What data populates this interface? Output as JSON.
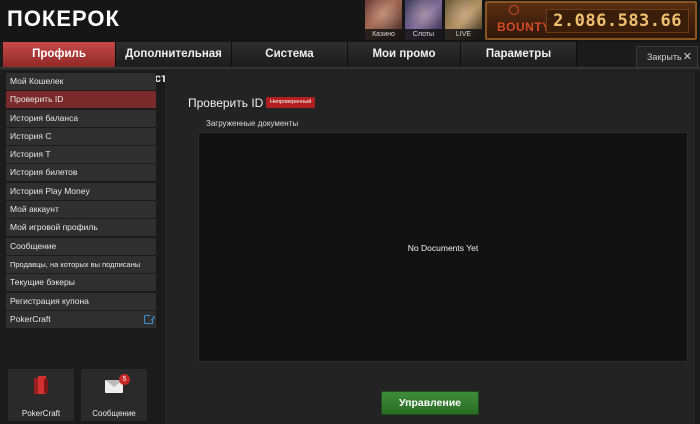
{
  "header": {
    "logo": "ПОКЕРОК",
    "thumbnails": [
      {
        "label": "Казино"
      },
      {
        "label": "Слоты"
      },
      {
        "label": "LIVE Казино"
      }
    ],
    "bounty": {
      "logo": "BOUNTY",
      "amount": "2.086.583.66"
    }
  },
  "tabs": [
    {
      "label": "Профиль",
      "active": true
    },
    {
      "label": "Дополнительная ставка"
    },
    {
      "label": "Система вознаграждений"
    },
    {
      "label": "Мои промо"
    },
    {
      "label": "Параметры"
    }
  ],
  "close_tab": {
    "label": "Закрыть",
    "icon": "close-icon",
    "glyph": "✕"
  },
  "sidebar": {
    "items": [
      {
        "label": "Мой Кошелек"
      },
      {
        "label": "Проверить ID",
        "active": true
      },
      {
        "label": "История баланса"
      },
      {
        "label": "История С"
      },
      {
        "label": "История Т"
      },
      {
        "label": "История билетов"
      },
      {
        "label": "История Play Money"
      },
      {
        "label": "Мой аккаунт"
      },
      {
        "label": "Мой игровой профиль"
      },
      {
        "label": "Сообщение"
      },
      {
        "label": "Продавцы, на которых вы подписаны"
      },
      {
        "label": "Текущие бэкеры"
      },
      {
        "label": "Регистрация купона"
      },
      {
        "label": "PokerCraft",
        "icon": "external-link-icon"
      }
    ],
    "bottom_buttons": [
      {
        "label": "PokerCraft",
        "icon": "pokercraft-icon"
      },
      {
        "label": "Сообщение",
        "icon": "envelope-icon",
        "badge": "5"
      }
    ]
  },
  "main": {
    "title": "Проверить ID",
    "status_badge": "Непроверенный",
    "documents_label": "Загруженные документы",
    "empty_text": "No Documents Yet",
    "manage_button": "Управление"
  },
  "colors": {
    "accent_red": "#b21f1f",
    "active_tab": "#c64a48",
    "button_green": "#3f8f3a",
    "background": "#1b1b1b"
  }
}
